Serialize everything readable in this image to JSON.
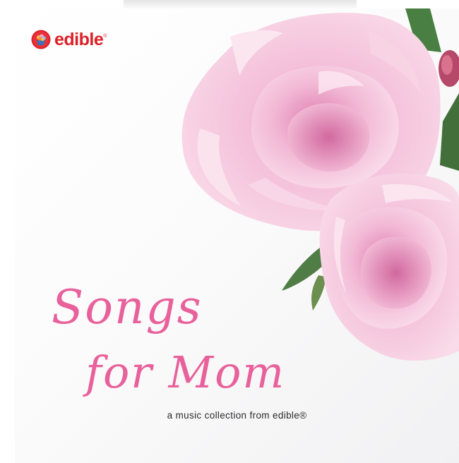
{
  "brand": {
    "name": "edible",
    "registered_mark": "®",
    "accent_color": "#dd1f26",
    "icon": "cupcake-logo-icon"
  },
  "cover": {
    "title_line_1": "Songs",
    "title_line_2": "for Mom",
    "title_color": "#e8619b",
    "tagline": "a music collection from edible®"
  },
  "image": {
    "subject": "pink peony flowers",
    "petal_colors": [
      "#f6c6dd",
      "#eda6c9",
      "#d86fa6"
    ],
    "leaf_color": "#4f7a45"
  }
}
